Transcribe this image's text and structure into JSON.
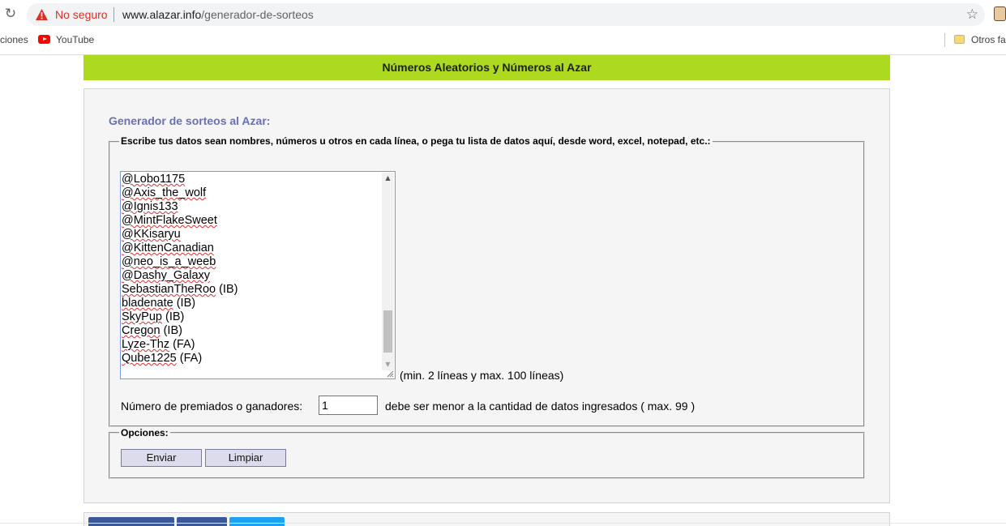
{
  "browser": {
    "security_label": "No seguro",
    "url_host": "www.alazar.info",
    "url_path": "/generador-de-sorteos",
    "bookmarks": [
      {
        "label": "ciones"
      },
      {
        "label": "YouTube"
      },
      {
        "label": "Otros fa"
      }
    ]
  },
  "page": {
    "banner_title": "Números Aleatorios y Números al Azar",
    "generator_title": "Generador de sorteos al Azar:",
    "data_legend": "Escribe tus datos sean nombres, números u otros en cada línea, o pega tu lista de datos aquí, desde word, excel, notepad, etc.:",
    "entries": [
      {
        "text": "@Lobo1175",
        "suffix": ""
      },
      {
        "text": "@Axis_the_wolf",
        "suffix": ""
      },
      {
        "text": "@Ignis133",
        "suffix": ""
      },
      {
        "text": "@MintFlakeSweet",
        "suffix": ""
      },
      {
        "text": "@KKisaryu",
        "suffix": ""
      },
      {
        "text": "@KittenCanadian",
        "suffix": ""
      },
      {
        "text": "@neo_is_a_weeb",
        "suffix": ""
      },
      {
        "text": "@Dashy_Galaxy",
        "suffix": ""
      },
      {
        "text": "SebastianTheRoo",
        "suffix": " (IB)"
      },
      {
        "text": "bladenate",
        "suffix": " (IB)"
      },
      {
        "text": "SkyPup",
        "suffix": " (IB)"
      },
      {
        "text": "Cregon",
        "suffix": " (IB)"
      },
      {
        "text": "Lyze-Thz",
        "suffix": " (FA)"
      },
      {
        "text": "Qube1225",
        "suffix": " (FA)"
      }
    ],
    "lines_hint": "(min. 2 líneas y max. 100 líneas)",
    "winners_label": "Número de premiados o ganadores:",
    "winners_value": "1",
    "winners_note": "debe ser menor a la cantidad de datos ingresados ( max. 99 )",
    "options_legend": "Opciones:",
    "send_label": "Enviar",
    "clear_label": "Limpiar"
  },
  "colors": {
    "banner": "#add91f",
    "title": "#6a6fb3",
    "insecure": "#d93025"
  }
}
